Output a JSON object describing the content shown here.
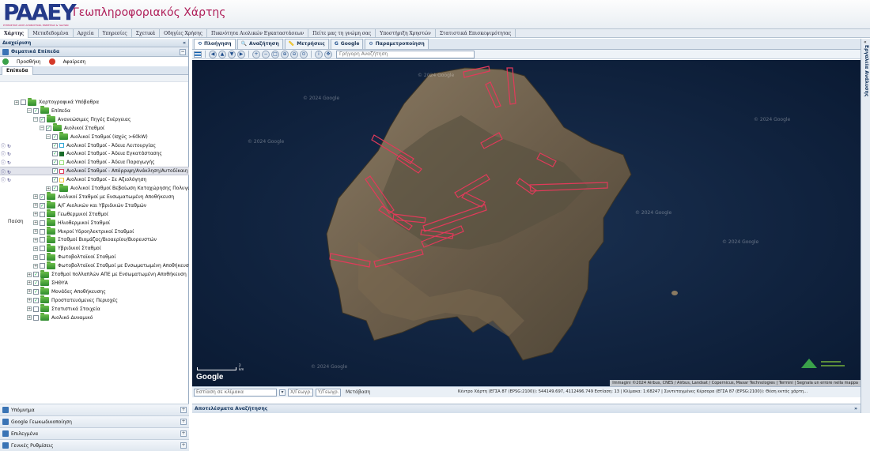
{
  "header": {
    "logo_text": "PAAEY",
    "logo_tagline": "ΡΥΘΜΙΣΤΙΚΗ ΑΡΧΗ ΑΠΟΒΛΗΤΩΝ, ΕΝΕΡΓΕΙΑΣ & ΥΔΑΤΩΝ",
    "site_title": "Γεωπληροφοριακός Χάρτης"
  },
  "menu": [
    "Χάρτης",
    "Μεταδεδομένα",
    "Αρχεία",
    "Υπηρεσίες",
    "Σχετικά",
    "Οδηγίες Χρήσης",
    "Πυκνότητα Αιολικών Εγκαταστάσεων",
    "Πείτε μας τη γνώμη σας",
    "Υποστήριξη Χρηστών",
    "Στατιστικά Επισκεψιμότητας"
  ],
  "left": {
    "title": "Διαχείριση",
    "collapse": "«",
    "section": "Θεματικά Επίπεδα",
    "section_btn": "−",
    "add": "Προσθήκη",
    "remove": "Αφαίρεση",
    "tab": "Επίπεδα",
    "pause": "Παύση",
    "tree": [
      {
        "label": "Χαρτογραφικά Υπόβαθρα",
        "indent": 18,
        "exp": "+",
        "cb": "",
        "type": "folder"
      },
      {
        "label": "Επίπεδα",
        "indent": 34,
        "exp": "−",
        "cb": "✓",
        "type": "folder"
      },
      {
        "label": "Ανανεώσιμες Πηγές Ενέργειας",
        "indent": 42,
        "exp": "−",
        "cb": "✓",
        "type": "folder"
      },
      {
        "label": "Αιολικοί Σταθμοί",
        "indent": 50,
        "exp": "−",
        "cb": "✓",
        "type": "folder"
      },
      {
        "label": "Αιολικοί Σταθμοί (Ισχύς >60kW)",
        "indent": 58,
        "exp": "−",
        "cb": "✓",
        "type": "folder"
      },
      {
        "label": "Αιολικοί Σταθμοί - Άδεια Λειτουργίας",
        "indent": 66,
        "exp": "",
        "cb": "✓",
        "type": "swatch",
        "color": "#2fa5d6",
        "ctrls": true
      },
      {
        "label": "Αιολικοί Σταθμοί - Άδεια Εγκατάστασης",
        "indent": 66,
        "exp": "",
        "cb": "✓",
        "type": "swatch",
        "color": "#1a6b2a",
        "ctrls": true
      },
      {
        "label": "Αιολικοί Σταθμοί - Άδεια Παραγωγής",
        "indent": 66,
        "exp": "",
        "cb": "✓",
        "type": "swatch",
        "color": "#9be07a",
        "ctrls": true
      },
      {
        "label": "Αιολικοί Σταθμοί - Απόρριψη/Ανάκληση/Αυτοδίκαιη",
        "indent": 66,
        "exp": "",
        "cb": "✓",
        "type": "swatch",
        "color": "#e23a5a",
        "ctrls": true,
        "selected": true
      },
      {
        "label": "Αιολικοί Σταθμοί - Σε Αξιολόγηση",
        "indent": 66,
        "exp": "",
        "cb": "✓",
        "type": "swatch",
        "color": "#f3c63a",
        "ctrls": true
      },
      {
        "label": "Αιολικοί Σταθμοί Βεβαίωση Καταχώρησης Πολυγώνου",
        "indent": 58,
        "exp": "+",
        "cb": "✓",
        "type": "folder"
      },
      {
        "label": "Αιολικοί Σταθμοί με Ενσωματωμένη Αποθήκευση",
        "indent": 42,
        "exp": "+",
        "cb": "✓",
        "type": "folder"
      },
      {
        "label": "Α/Γ Αιολικών και Υβριδικών Σταθμών",
        "indent": 42,
        "exp": "+",
        "cb": "✓",
        "type": "folder"
      },
      {
        "label": "Γεωθερμικοί Σταθμοί",
        "indent": 42,
        "exp": "+",
        "cb": "",
        "type": "folder"
      },
      {
        "label": "Ηλιοθερμικοί Σταθμοί",
        "indent": 42,
        "exp": "+",
        "cb": "",
        "type": "folder"
      },
      {
        "label": "Μικροί Υδροηλεκτρικοί Σταθμοί",
        "indent": 42,
        "exp": "+",
        "cb": "",
        "type": "folder"
      },
      {
        "label": "Σταθμοί Βιομάζας/Βιοαερίου/Βιορευστών",
        "indent": 42,
        "exp": "+",
        "cb": "",
        "type": "folder"
      },
      {
        "label": "Υβριδικοί Σταθμοί",
        "indent": 42,
        "exp": "+",
        "cb": "",
        "type": "folder"
      },
      {
        "label": "Φωτοβολταϊκοί Σταθμοί",
        "indent": 42,
        "exp": "+",
        "cb": "",
        "type": "folder"
      },
      {
        "label": "Φωτοβολταϊκοί Σταθμοί με Ενσωματωμένη Αποθήκευση",
        "indent": 42,
        "exp": "+",
        "cb": "",
        "type": "folder"
      },
      {
        "label": "Σταθμοί πολλαπλών ΑΠΕ με Ενσωματωμένη Αποθήκευση",
        "indent": 34,
        "exp": "+",
        "cb": "✓",
        "type": "folder"
      },
      {
        "label": "ΣΗΘΥΑ",
        "indent": 34,
        "exp": "+",
        "cb": "✓",
        "type": "folder"
      },
      {
        "label": "Μονάδες Αποθήκευσης",
        "indent": 34,
        "exp": "+",
        "cb": "✓",
        "type": "folder"
      },
      {
        "label": "Προστατευόμενες Περιοχές",
        "indent": 34,
        "exp": "+",
        "cb": "✓",
        "type": "folder"
      },
      {
        "label": "Στατιστικά Στοιχεία",
        "indent": 34,
        "exp": "+",
        "cb": "",
        "type": "folder"
      },
      {
        "label": "Αιολικό Δυναμικό",
        "indent": 34,
        "exp": "+",
        "cb": "",
        "type": "folder"
      }
    ],
    "accordion": [
      {
        "label": "Υπόμνημα",
        "btn": "+"
      },
      {
        "label": "Google Γεωκωδικοποίηση",
        "btn": "+"
      },
      {
        "label": "Επιλεγμένα",
        "btn": "+"
      },
      {
        "label": "Γενικές Ρυθμίσεις",
        "btn": "+"
      }
    ]
  },
  "map": {
    "tabs": [
      "Πλοήγηση",
      "Αναζήτηση",
      "Μετρήσεις",
      "Google",
      "Παραμετροποίηση"
    ],
    "quick_search_placeholder": "Γρήγορη Αναζήτηση",
    "watermark": "© 2024 Google",
    "google_label": "Google",
    "scale_label": "2 km",
    "attribution": "Immagini ©2024 Airbus, CNES / Airbus, Landsat / Copernicus, Maxar Technologies | Termini | Segnala un errore nella mappa",
    "status": {
      "search_placeholder": "Εστίαση σε κλίμακα",
      "x_placeholder": "Χ/Γεωγρ.",
      "y_placeholder": "Υ/Γεωγρ.",
      "go": "Μετάβαση",
      "info": "Κέντρο Χάρτη (ΕΓΣΑ 87 (EPSG:2100)): 544149.697, 4112496.749 Εστίαση: 13 | Κλίμακα: 1:68247 | Συντεταγμένες Κέρσορα (ΕΓΣΑ 87 (EPSG:2100)): Θέση εκτός χάρτη..."
    },
    "results_title": "Αποτελέσματα Αναζήτησης",
    "results_btn": "»"
  },
  "right": {
    "label": "Εργαλεία Ανάλυσης",
    "btn": "«"
  },
  "colors": {
    "accent": "#243a89",
    "brand": "#b0205a",
    "sea": "#0c1c35",
    "land": "#6e6150",
    "polygon": "#e23a5a"
  }
}
